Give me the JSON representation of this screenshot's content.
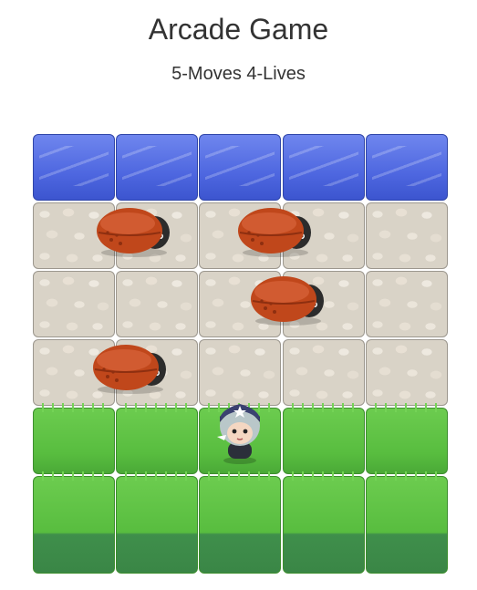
{
  "header": {
    "title": "Arcade Game",
    "status": "5-Moves 4-Lives"
  },
  "board": {
    "columns": 5,
    "rows": [
      "water",
      "stone",
      "stone",
      "stone",
      "grass",
      "grass"
    ],
    "enemies": [
      {
        "row": 1,
        "col": 1.0
      },
      {
        "row": 1,
        "col": 2.7
      },
      {
        "row": 2,
        "col": 2.85
      },
      {
        "row": 3,
        "col": 0.95
      }
    ],
    "player": {
      "row": 4,
      "col": 2
    }
  },
  "colors": {
    "water": "#4e67e0",
    "stone": "#d9d3c7",
    "grass": "#58bd3f",
    "enemy_body": "#c0471b"
  },
  "icons": {
    "enemy": "ladybug-enemy-icon",
    "player": "player-character-icon"
  }
}
